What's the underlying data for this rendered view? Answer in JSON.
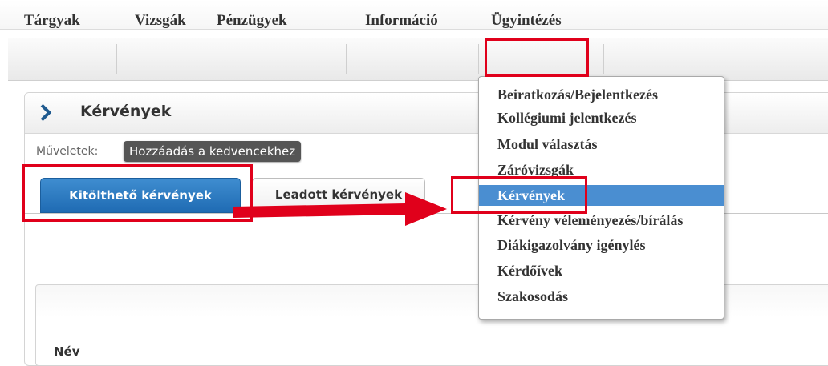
{
  "nav": {
    "items": [
      "Tárgyak",
      "Vizsgák",
      "Pénzügyek",
      "Információ",
      "Ügyintézés"
    ]
  },
  "dropdown": {
    "items": [
      "Beiratkozás/Bejelentkezés",
      "Kollégiumi jelentkezés",
      "Modul választás",
      "Záróvizsgák",
      "Kérvények",
      "Kérvény véleményezés/bírálás",
      "Diákigazolvány igénylés",
      "Kérdőívek",
      "Szakosodás"
    ],
    "active_index": 4
  },
  "panel": {
    "title": "Kérvények",
    "actions_label": "Műveletek:",
    "favorite_button": "Hozzáadás a kedvencekhez"
  },
  "tabs": {
    "active": "Kitölthető kérvények",
    "inactive": "Leadott kérvények"
  },
  "table": {
    "name_header": "Név"
  },
  "colors": {
    "highlight": "#e0001b",
    "tab_active": "#2a77bf",
    "menu_active": "#4a8ed1"
  }
}
